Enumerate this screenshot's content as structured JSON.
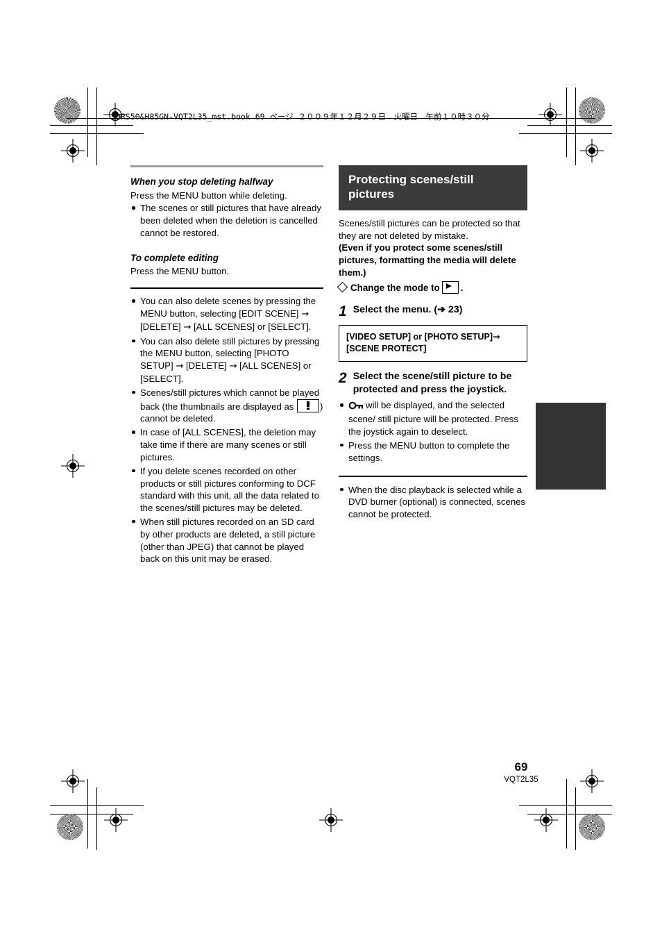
{
  "book_header": "SDRS50&H85GN-VQT2L35_mst.book  69 ページ  ２００９年１２月２９日　火曜日　午前１０時３０分",
  "left_column": {
    "heading_1": "When you stop deleting halfway",
    "para_1": "Press the MENU button while deleting.",
    "bullet_1": "The scenes or still pictures that have already been deleted when the deletion is cancelled cannot be restored.",
    "heading_2": "To complete editing",
    "para_2": "Press the MENU button.",
    "notes": [
      {
        "pre": "You can also delete scenes by pressing the MENU button, selecting [EDIT SCENE] ",
        "arrow1": "→",
        "mid1": " [DELETE] ",
        "arrow2": "→",
        "post": " [ALL SCENES] or [SELECT]."
      },
      {
        "pre": "You can also delete still pictures by pressing the MENU button, selecting [PHOTO SETUP] ",
        "arrow1": "→",
        "mid1": " [DELETE] ",
        "arrow2": "→",
        "post": " [ALL SCENES] or [SELECT]."
      },
      {
        "pre": "Scenes/still pictures which cannot be played back (the thumbnails are displayed as ",
        "icon": "exclamation-thumbnail-icon",
        "post": ") cannot be deleted."
      },
      {
        "text": "In case of [ALL SCENES], the deletion may take time if there are many scenes or still pictures."
      },
      {
        "text": "If you delete scenes recorded on other products or still pictures conforming to DCF standard with this unit, all the data related to the scenes/still pictures may be deleted."
      },
      {
        "text": "When still pictures recorded on an SD card by other products are deleted, a still picture (other than JPEG) that cannot be played back on this unit may be erased."
      }
    ]
  },
  "right_column": {
    "section_title": "Protecting scenes/still pictures",
    "section_title_bg": "#3b3b3b",
    "intro": "Scenes/still pictures can be protected so that they are not deleted by mistake.",
    "intro_bold": "(Even if you protect some scenes/still pictures, formatting the media will delete them.)",
    "mode_prefix": "Change the mode to",
    "mode_icon": "playback-mode-icon",
    "mode_suffix": ".",
    "step1": {
      "number": "1",
      "text": "Select the menu. (➔ 23)",
      "menu_box_line1_a": "[VIDEO SETUP] or [PHOTO SETUP]",
      "menu_box_arrow": "→",
      "menu_box_line2": "[SCENE PROTECT]"
    },
    "step2": {
      "number": "2",
      "text": "Select the scene/still picture to be protected and press the joystick.",
      "bullet_1_icon": "key-protect-icon",
      "bullet_1": "will be displayed, and the selected scene/ still picture will be protected. Press the joystick again to deselect.",
      "bullet_2": "Press the MENU button to complete the settings."
    },
    "footnote": "When the disc playback is selected while a DVD burner (optional) is connected, scenes cannot be protected."
  },
  "footer": {
    "page_number": "69",
    "page_code": "VQT2L35"
  }
}
